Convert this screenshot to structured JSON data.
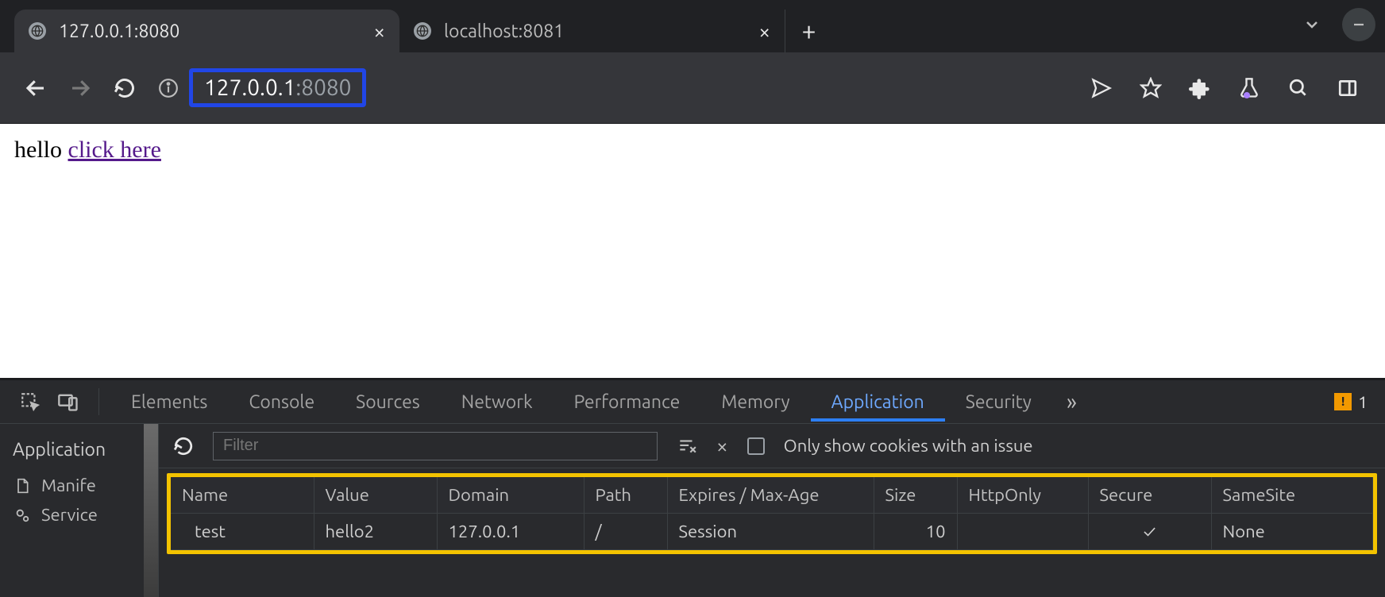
{
  "browser": {
    "tabs": [
      {
        "title": "127.0.0.1:8080",
        "active": true
      },
      {
        "title": "localhost:8081",
        "active": false
      }
    ],
    "url": {
      "host": "127.0.0.1",
      "port": ":8080"
    }
  },
  "page": {
    "text": "hello ",
    "link_text": "click here"
  },
  "devtools": {
    "panels": [
      "Elements",
      "Console",
      "Sources",
      "Network",
      "Performance",
      "Memory",
      "Application",
      "Security"
    ],
    "active_panel": "Application",
    "more": "»",
    "warning_count": "1",
    "sidebar": {
      "title": "Application",
      "items": [
        {
          "label": "Manife",
          "icon": "file"
        },
        {
          "label": "Service",
          "icon": "gears"
        }
      ]
    },
    "toolbar": {
      "filter_placeholder": "Filter",
      "checkbox_label": "Only show cookies with an issue"
    },
    "cookies": {
      "headers": [
        "Name",
        "Value",
        "Domain",
        "Path",
        "Expires / Max-Age",
        "Size",
        "HttpOnly",
        "Secure",
        "SameSite"
      ],
      "rows": [
        {
          "name": "test",
          "value": "hello2",
          "domain": "127.0.0.1",
          "path": "/",
          "expires": "Session",
          "size": "10",
          "httponly": "",
          "secure": "✓",
          "samesite": "None"
        }
      ]
    }
  }
}
